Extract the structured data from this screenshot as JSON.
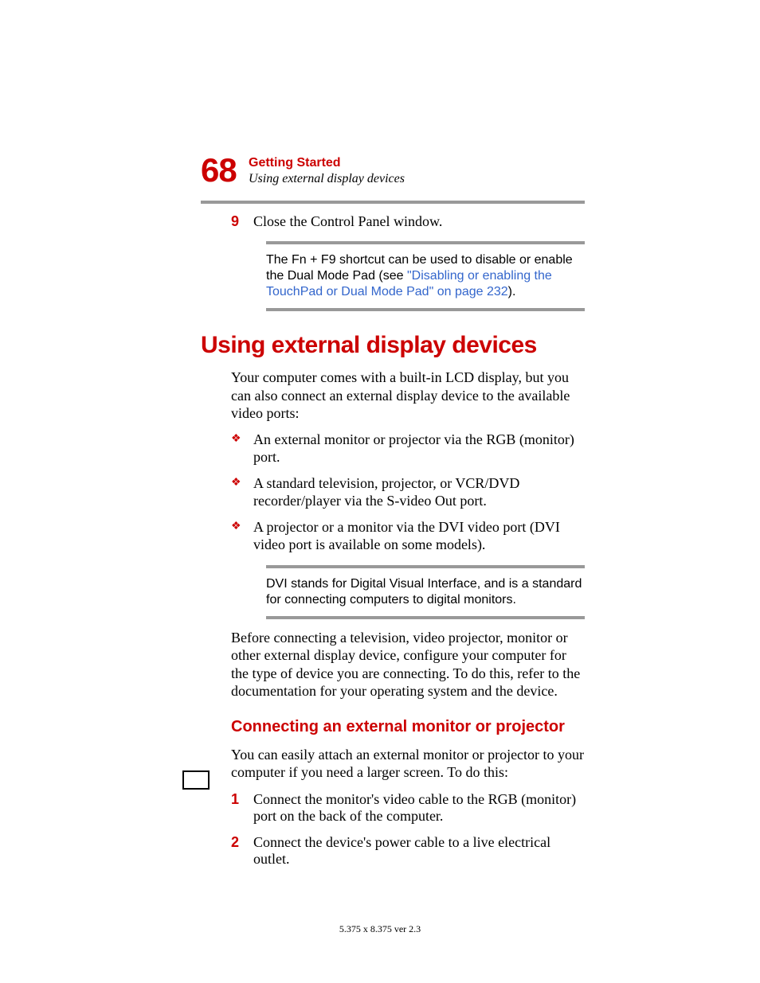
{
  "header": {
    "page_number": "68",
    "chapter": "Getting Started",
    "subtitle": "Using external display devices"
  },
  "step9": {
    "num": "9",
    "text": "Close the Control Panel window."
  },
  "note1": {
    "pre": "The Fn + F9 shortcut can be used to disable or enable the Dual Mode Pad (see ",
    "link": "\"Disabling or enabling the TouchPad or Dual Mode Pad\" on page 232",
    "post": ")."
  },
  "h1": "Using external display devices",
  "intro": "Your computer comes with a built-in LCD display, but you can also connect an external display device to the available video ports:",
  "bullets": [
    "An external monitor or projector via the RGB (monitor) port.",
    "A standard television, projector, or VCR/DVD recorder/player via the S-video Out port.",
    "A projector or a monitor via the DVI video port (DVI video port is available on some models)."
  ],
  "note2": "DVI stands for Digital Visual Interface, and is a standard for connecting computers to digital monitors.",
  "para2": "Before connecting a television, video projector, monitor or other external display device, configure your computer for the type of device you are connecting. To do this, refer to the documentation for your operating system and the device.",
  "h2": "Connecting an external monitor or projector",
  "para3": "You can easily attach an external monitor or projector to your computer if you need a larger screen. To do this:",
  "steps": [
    {
      "num": "1",
      "text": "Connect the monitor's video cable to the RGB (monitor) port on the back of the computer."
    },
    {
      "num": "2",
      "text": "Connect the device's power cable to a live electrical outlet."
    }
  ],
  "footer": "5.375 x 8.375 ver 2.3"
}
